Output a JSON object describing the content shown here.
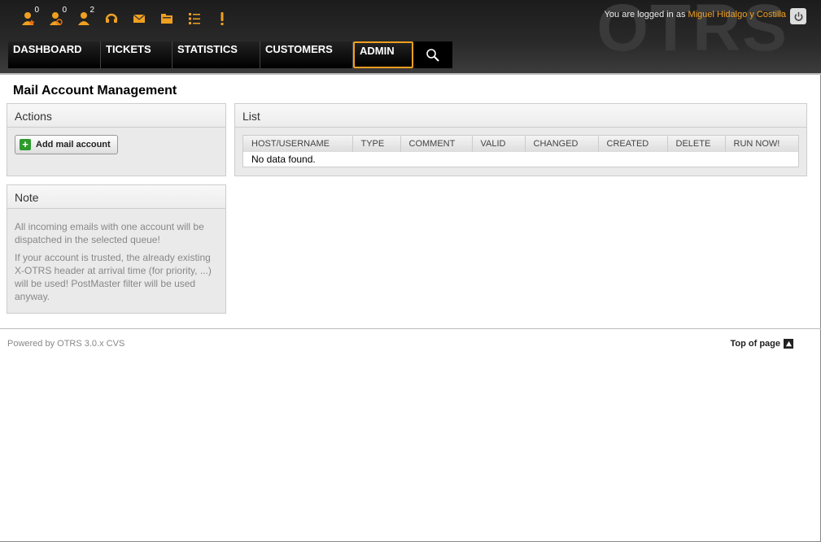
{
  "header": {
    "brand": "OTRS",
    "login_prefix": "You are logged in as",
    "user_name": "Miguel Hidalgo y Costilla",
    "toolbar": [
      {
        "name": "locked-tickets-new-icon",
        "count": "0"
      },
      {
        "name": "watched-tickets-icon",
        "count": "0"
      },
      {
        "name": "responsible-tickets-icon",
        "count": "2"
      },
      {
        "name": "new-phone-ticket-icon",
        "count": ""
      },
      {
        "name": "new-email-ticket-icon",
        "count": ""
      },
      {
        "name": "queue-view-icon",
        "count": ""
      },
      {
        "name": "status-view-icon",
        "count": ""
      },
      {
        "name": "escalation-view-icon",
        "count": ""
      }
    ],
    "nav": [
      "DASHBOARD",
      "TICKETS",
      "STATISTICS",
      "CUSTOMERS",
      "ADMIN"
    ],
    "accent": "#f0a020"
  },
  "page": {
    "title": "Mail Account Management"
  },
  "actions": {
    "title": "Actions",
    "add_button": "Add mail account"
  },
  "note": {
    "title": "Note",
    "p1": "All incoming emails with one account will be dispatched in the selected queue!",
    "p2": "If your account is trusted, the already existing X-OTRS header at arrival time (for priority, ...) will be used! PostMaster filter will be used anyway."
  },
  "list": {
    "title": "List",
    "columns": [
      "HOST/USERNAME",
      "TYPE",
      "COMMENT",
      "VALID",
      "CHANGED",
      "CREATED",
      "DELETE",
      "RUN NOW!"
    ],
    "empty_message": "No data found."
  },
  "footer": {
    "powered": "Powered by OTRS 3.0.x CVS",
    "top_link": "Top of page"
  }
}
